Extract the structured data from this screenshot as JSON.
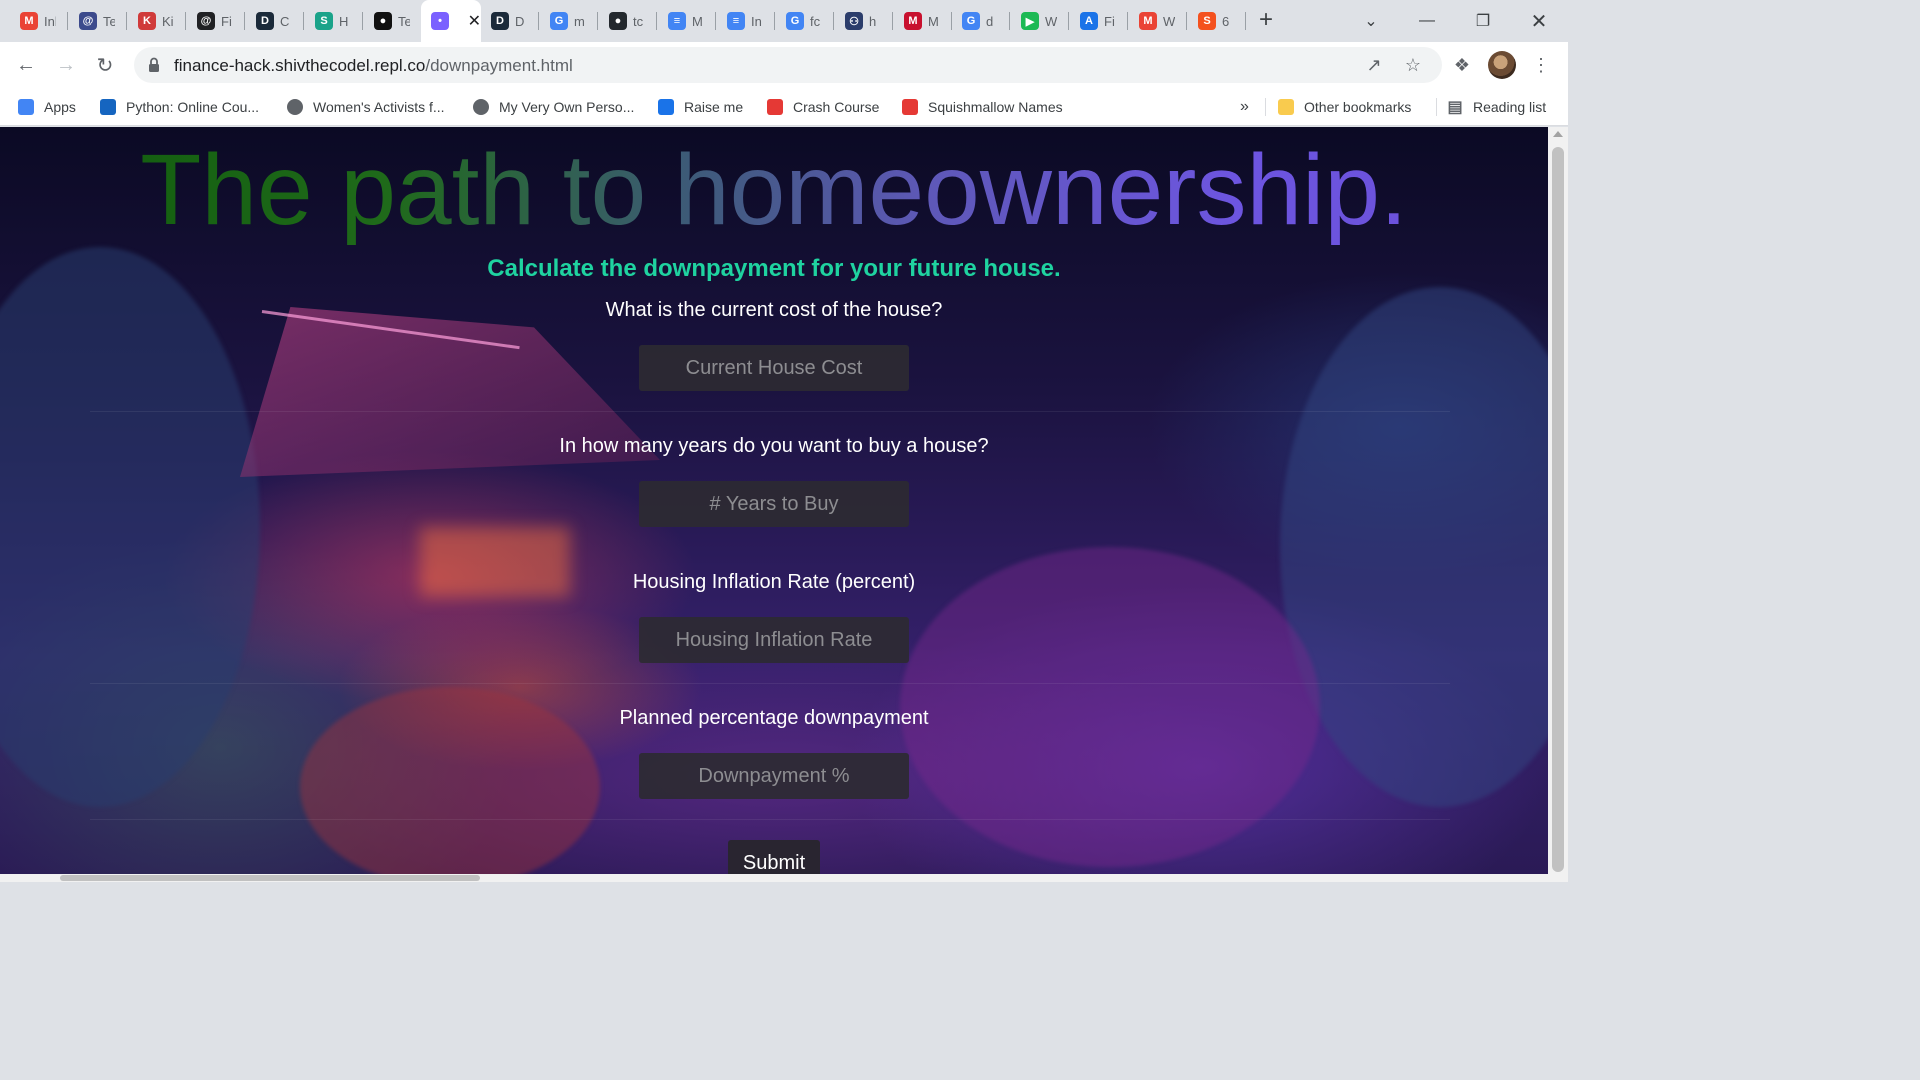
{
  "browser": {
    "tabs": [
      {
        "title": "Inbox",
        "icon": "gmail-icon",
        "color": "#ea4335",
        "letter": "M"
      },
      {
        "title": "Te",
        "icon": "circle-icon",
        "color": "#3c4a8c",
        "letter": "@"
      },
      {
        "title": "Ki",
        "icon": "kahoot-icon",
        "color": "#d03a3a",
        "letter": "K"
      },
      {
        "title": "Fi",
        "icon": "swirl-icon",
        "color": "#202124",
        "letter": "@"
      },
      {
        "title": "C",
        "icon": "d-icon",
        "color": "#1b2a3a",
        "letter": "D"
      },
      {
        "title": "H",
        "icon": "shield-icon",
        "color": "#1aa38a",
        "letter": "S"
      },
      {
        "title": "Te",
        "icon": "dot-icon",
        "color": "#111111",
        "letter": "●"
      },
      {
        "title": "",
        "icon": "chat-icon",
        "color": "#7b61ff",
        "letter": "•"
      },
      {
        "title": "D",
        "icon": "d-icon",
        "color": "#1b2a3a",
        "letter": "D"
      },
      {
        "title": "m",
        "icon": "google-icon",
        "color": "#4285f4",
        "letter": "G"
      },
      {
        "title": "tc",
        "icon": "github-icon",
        "color": "#24292e",
        "letter": "●"
      },
      {
        "title": "M",
        "icon": "docs-icon",
        "color": "#4285f4",
        "letter": "≡"
      },
      {
        "title": "In",
        "icon": "docs-icon",
        "color": "#4285f4",
        "letter": "≡"
      },
      {
        "title": "fc",
        "icon": "google-icon",
        "color": "#4285f4",
        "letter": "G"
      },
      {
        "title": "h",
        "icon": "robot-icon",
        "color": "#2b3d6b",
        "letter": "⚇"
      },
      {
        "title": "M",
        "icon": "m-icon",
        "color": "#c8102e",
        "letter": "M"
      },
      {
        "title": "d",
        "icon": "google-icon",
        "color": "#4285f4",
        "letter": "G"
      },
      {
        "title": "W",
        "icon": "play-icon",
        "color": "#1db954",
        "letter": "▶"
      },
      {
        "title": "Fi",
        "icon": "a-icon",
        "color": "#1a73e8",
        "letter": "A"
      },
      {
        "title": "W",
        "icon": "gmail-icon",
        "color": "#ea4335",
        "letter": "M"
      },
      {
        "title": "6",
        "icon": "s-icon",
        "color": "#f4511e",
        "letter": "S"
      }
    ],
    "url_host": "finance-hack.shivthecodel.repl.co",
    "url_path": "/downpayment.html",
    "bookmarks": [
      {
        "label": "Apps",
        "icon": "apps-grid-icon",
        "color": "#4285f4"
      },
      {
        "label": "Python: Online Cou...",
        "icon": "video-icon",
        "color": "#1565c0"
      },
      {
        "label": "Women's Activists f...",
        "icon": "globe-icon",
        "color": "#5f6368"
      },
      {
        "label": "My Very Own Perso...",
        "icon": "globe-icon",
        "color": "#5f6368"
      },
      {
        "label": "Raise me",
        "icon": "raise-icon",
        "color": "#1a73e8"
      },
      {
        "label": "Crash Course",
        "icon": "crash-icon",
        "color": "#e53935"
      },
      {
        "label": "Squishmallow Names",
        "icon": "flame-icon",
        "color": "#e53935"
      }
    ],
    "bookmarks_overflow": "»",
    "other_bookmarks": "Other bookmarks",
    "reading_list": "Reading list"
  },
  "page": {
    "title": "The path to homeownership.",
    "subtitle": "Calculate the downpayment for your future house.",
    "questions": [
      {
        "label": "What is the current cost of the house?",
        "placeholder": "Current House Cost"
      },
      {
        "label": "In how many years do you want to buy a house?",
        "placeholder": "# Years to Buy"
      },
      {
        "label": "Housing Inflation Rate (percent)",
        "placeholder": "Housing Inflation Rate"
      },
      {
        "label": "Planned percentage downpayment",
        "placeholder": "Downpayment %"
      }
    ],
    "submit": "Submit"
  }
}
